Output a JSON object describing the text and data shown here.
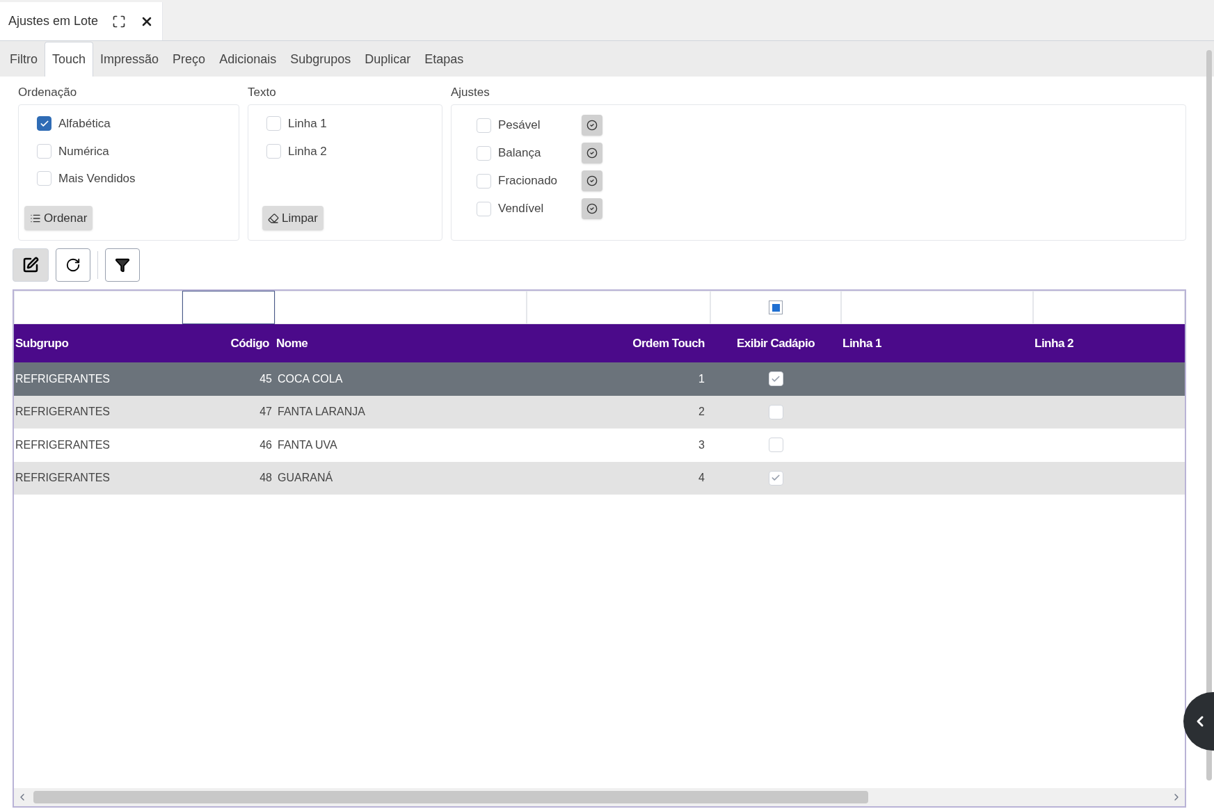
{
  "window": {
    "title": "Ajustes em Lote"
  },
  "tabs": [
    {
      "label": "Filtro",
      "selected": false
    },
    {
      "label": "Touch",
      "selected": true
    },
    {
      "label": "Impressão",
      "selected": false
    },
    {
      "label": "Preço",
      "selected": false
    },
    {
      "label": "Adicionais",
      "selected": false
    },
    {
      "label": "Subgrupos",
      "selected": false
    },
    {
      "label": "Duplicar",
      "selected": false
    },
    {
      "label": "Etapas",
      "selected": false
    }
  ],
  "ordenacao": {
    "label": "Ordenação",
    "options": [
      {
        "label": "Alfabética",
        "checked": true
      },
      {
        "label": "Numérica",
        "checked": false
      },
      {
        "label": "Mais Vendidos",
        "checked": false
      }
    ],
    "button": "Ordenar"
  },
  "texto": {
    "label": "Texto",
    "options": [
      {
        "label": "Linha 1",
        "checked": false
      },
      {
        "label": "Linha 2",
        "checked": false
      }
    ],
    "button": "Limpar"
  },
  "ajustes": {
    "label": "Ajustes",
    "items": [
      {
        "label": "Pesável",
        "checked": false
      },
      {
        "label": "Balança",
        "checked": false
      },
      {
        "label": "Fracionado",
        "checked": false
      },
      {
        "label": "Vendível",
        "checked": false
      }
    ]
  },
  "table": {
    "filters": [
      {
        "focused": false
      },
      {
        "focused": true
      },
      {
        "focused": false
      },
      {
        "focused": false
      },
      {
        "focused": false
      },
      {
        "focused": false
      },
      {
        "focused": false
      }
    ],
    "filter_exibir_checked": true,
    "columns": [
      "Subgrupo",
      "Código",
      "Nome",
      "Ordem Touch",
      "Exibir Cadápio",
      "Linha 1",
      "Linha 2"
    ],
    "rows": [
      {
        "subgrupo": "REFRIGERANTES",
        "codigo": "45",
        "nome": "COCA COLA",
        "ordem": "1",
        "exibir": true,
        "selected": true
      },
      {
        "subgrupo": "REFRIGERANTES",
        "codigo": "47",
        "nome": "FANTA LARANJA",
        "ordem": "2",
        "exibir": false,
        "selected": false
      },
      {
        "subgrupo": "REFRIGERANTES",
        "codigo": "46",
        "nome": "FANTA UVA",
        "ordem": "3",
        "exibir": false,
        "selected": false
      },
      {
        "subgrupo": "REFRIGERANTES",
        "codigo": "48",
        "nome": "GUARANÁ",
        "ordem": "4",
        "exibir": true,
        "selected": false
      }
    ]
  }
}
